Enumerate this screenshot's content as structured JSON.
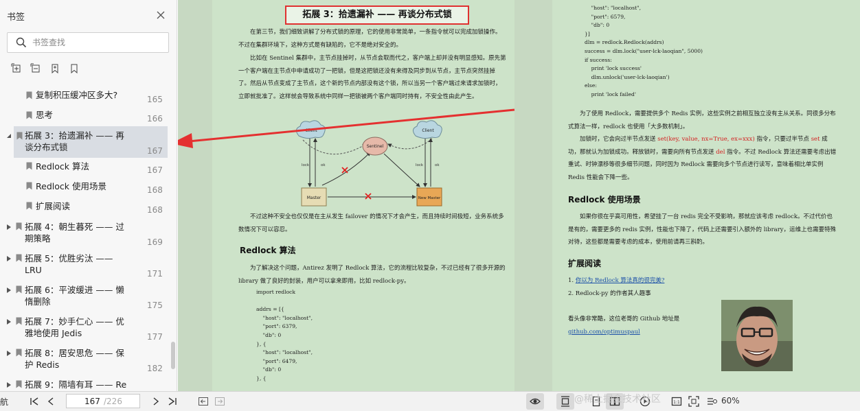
{
  "sidebar": {
    "title": "书签",
    "search_placeholder": "书签查找",
    "items": [
      {
        "label": "复制积压缓冲区多大?",
        "page": "165"
      },
      {
        "label": "思考",
        "page": "166"
      },
      {
        "label": "拓展 3：拾遗漏补 —— 再谈分布式锁",
        "page": "167"
      },
      {
        "label": "Redlock 算法",
        "page": "167"
      },
      {
        "label": "Redlock 使用场景",
        "page": "168"
      },
      {
        "label": "扩展阅读",
        "page": "168"
      },
      {
        "label": "拓展 4：朝生暮死 —— 过期策略",
        "page": "169"
      },
      {
        "label": "拓展 5：优胜劣汰 —— LRU",
        "page": "171"
      },
      {
        "label": "拓展 6：平波缓进 —— 懒惰删除",
        "page": "175"
      },
      {
        "label": "拓展 7：妙手仁心 —— 优雅地使用 Jedis",
        "page": "177"
      },
      {
        "label": "拓展 8：居安思危 —— 保护 Redis",
        "page": "182"
      },
      {
        "label": "拓展 9：隔墙有耳 —— Re",
        "page": ""
      }
    ]
  },
  "document": {
    "title": "拓展 3：拾遗漏补 —— 再谈分布式锁",
    "left": {
      "para1": "在第三节，我们细致讲解了分布式锁的原理，它的使用非常简单，一条指令就可以完成加锁操作。不过在集群环境下，这种方式是有缺陷的，它不是绝对安全的。",
      "para2": "比如在 Sentinel 集群中，主节点挂掉时，从节点会取而代之，客户端上却并没有明显感知。原先第一个客户端在主节点中申请成功了一把锁，但是这把锁还没有来得及同步到从节点，主节点突然挂掉了。然后从节点变成了主节点，这个新的节点内部没有这个锁，所以当另一个客户端过来请求加锁时，立即就批准了。这样就会导致系统中同样一把锁被两个客户端同时持有，不安全性由此产生。",
      "para3": "不过这种不安全也仅仅是在主从发生 failover 的情况下才会产生，而且持续时间极短，业务系统多数情况下可以容忍。",
      "heading": "Redlock 算法",
      "para4": "为了解决这个问题，Antirez 发明了 Redlock 算法，它的流程比较复杂，不过已经有了很多开源的 library 做了良好的封装，用户可以拿来即用，比如 redlock-py。",
      "code": "import redlock\n\naddrs = [{\n    \"host\": \"localhost\",\n    \"port\": 6379,\n    \"db\": 0\n}, {\n    \"host\": \"localhost\",\n    \"port\": 6479,\n    \"db\": 0\n}, {"
    },
    "diagram": {
      "client": "Client",
      "sentinel": "Sentinel",
      "master": "Master",
      "new_master": "New Master",
      "lock": "lock",
      "ok": "ok"
    },
    "right": {
      "code": "    \"host\": \"localhost\",\n    \"port\": 6579,\n    \"db\": 0\n}]\ndlm = redlock.Redlock(addrs)\nsuccess = dlm.lock(\"user-lck-laoqian\", 5000)\nif success:\n    print 'lock success'\n    dlm.unlock('user-lck-laoqian')\nelse:\n    print 'lock failed'",
      "para1": "为了使用 Redlock，需要提供多个 Redis 实例，这些实例之前相互独立没有主从关系。同很多分布式算法一样，redlock 也使用「大多数机制」。",
      "para2_a": "加锁时，它会向过半节点发送 ",
      "para2_red1": "set(key, value, nx=True, ex=xxx)",
      "para2_b": " 指令，只要过半节点 ",
      "para2_red2": "set",
      "para2_c": " 成功，那就认为加锁成功。释放锁时，需要向所有节点发送 ",
      "para2_red3": "del",
      "para2_d": " 指令。不过 Redlock 算法还需要考虑出错重试、时钟漂移等很多细节问题，同时因为 Redlock 需要向多个节点进行读写，意味着相比单实例 Redis 性能会下降一些。",
      "heading1": "Redlock 使用场景",
      "para3": "如果你很在乎高可用性，希望挂了一台 redis 完全不受影响，那就应该考虑 redlock。不过代价也是有的，需要更多的 redis 实例，性能也下降了，代码上还需要引入额外的 library，运维上也需要特殊对待，这些都是需要考虑的成本，使用前请再三斟酌。",
      "heading2": "扩展阅读",
      "read1_num": "1. ",
      "read1_link": "你以为 Redlock 算法真的很完美?",
      "read2": "2. Redlock-py 的作者其人趣事",
      "para4": "看头像非常酷，这位老哥的 Github 地址是",
      "github_link": "github.com/optimuspaul"
    }
  },
  "bottombar": {
    "nav_label": "航",
    "page_current": "167",
    "page_total": "/226",
    "zoom": "60%"
  },
  "watermark": "@稀土掘金技术社区",
  "colors": {
    "accent_red": "#e03030",
    "page_bg": "#cde3c9",
    "selected": "#d9dde3"
  }
}
